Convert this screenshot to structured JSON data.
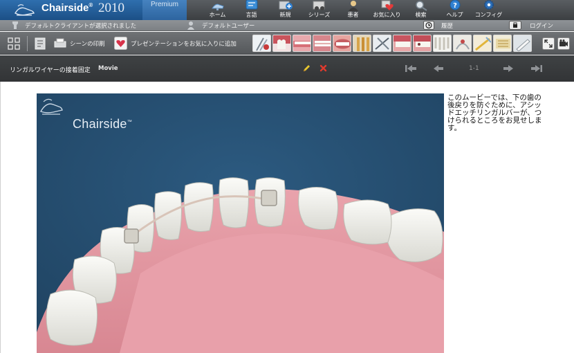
{
  "app": {
    "name": "Chairside",
    "trademark": "®",
    "year": "2010",
    "edition": "Premium",
    "brand_color": "#1b4f86"
  },
  "nav": [
    {
      "label": "ホーム",
      "icon": "chair-icon"
    },
    {
      "label": "言語",
      "icon": "globe-icon"
    },
    {
      "label": "新規",
      "icon": "new-icon"
    },
    {
      "label": "シリーズ",
      "icon": "film-icon"
    },
    {
      "label": "患者",
      "icon": "patient-icon"
    },
    {
      "label": "お気に入り",
      "icon": "heart-icon"
    },
    {
      "label": "検索",
      "icon": "search-icon"
    },
    {
      "label": "ヘルプ",
      "icon": "help-icon"
    },
    {
      "label": "コンフィグ",
      "icon": "config-icon"
    }
  ],
  "status": {
    "client": "デフォルトクライアントが選択されました",
    "user": "デフォルトユーザー",
    "history": "履歴",
    "login": "ログイン"
  },
  "toolbar": {
    "print_scene": "シーンの印刷",
    "add_favorite": "プレゼンテーションをお気に入りに追加",
    "thumbnails": [
      "dental-tools",
      "crown",
      "denture",
      "smile",
      "lips",
      "implant",
      "bridge",
      "teeth-row",
      "extraction",
      "incisors",
      "ortho",
      "brush",
      "veneer",
      "whitening"
    ]
  },
  "movie": {
    "title": "リンガルワイヤーの接着固定",
    "kind": "Movie",
    "page": "1-1",
    "accent": "#e6c62f",
    "delete_color": "#e03a2e"
  },
  "video": {
    "watermark": "Chairside",
    "watermark_tm": "™",
    "background": "#244b6c"
  },
  "description": "このムービーでは、下の歯の後戻りを防ぐために、アシッドエッチリンガルバーが、つけられるところをお見せします。"
}
